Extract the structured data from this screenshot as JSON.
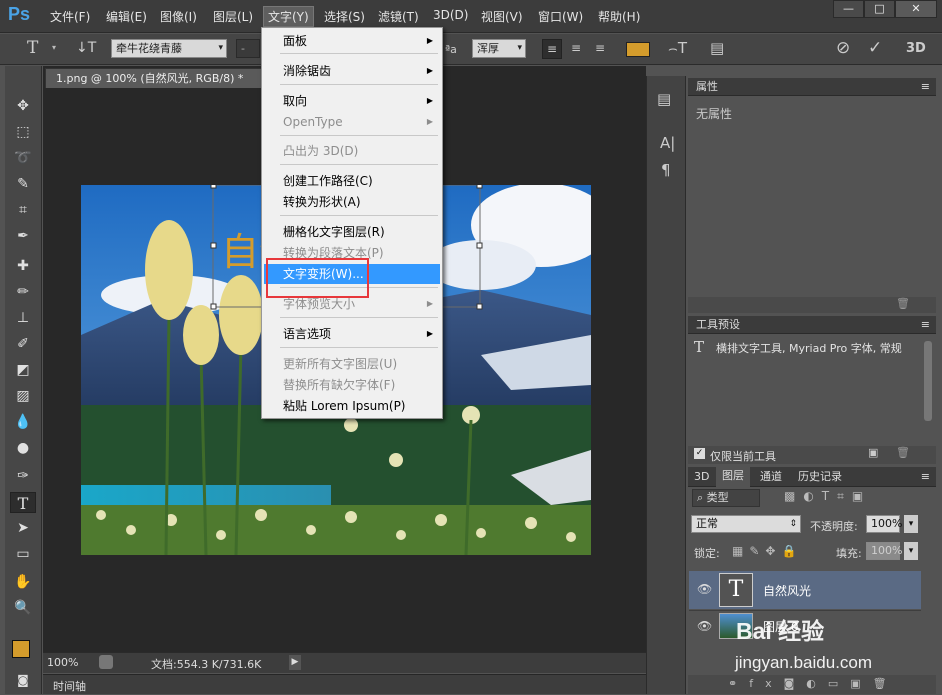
{
  "app": {
    "logo": "Ps"
  },
  "menubar": {
    "items": [
      "文件(F)",
      "编辑(E)",
      "图像(I)",
      "图层(L)",
      "文字(Y)",
      "选择(S)",
      "滤镜(T)",
      "3D(D)",
      "视图(V)",
      "窗口(W)",
      "帮助(H)"
    ],
    "active_index": 4,
    "window_buttons": [
      "—",
      "□",
      "✕"
    ]
  },
  "options": {
    "font_family": "牵牛花绕青藤",
    "font_style": "-",
    "aa_label": "ªa",
    "aa_mode": "浑厚",
    "text_color": "#d49c2c"
  },
  "document": {
    "tab_title": "1.png @ 100% (自然风光, RGB/8) *",
    "tab_close": "×",
    "zoom": "100%",
    "doc_info": "文档:554.3 K/731.6K",
    "timeline_label": "时间轴"
  },
  "dropdown": {
    "items": [
      {
        "label": "面板",
        "submenu": true,
        "disabled": false
      },
      {
        "label": "消除锯齿",
        "submenu": true,
        "disabled": false
      },
      {
        "label": "取向",
        "submenu": true,
        "disabled": false
      },
      {
        "label": "OpenType",
        "submenu": true,
        "disabled": true
      },
      {
        "label": "凸出为 3D(D)",
        "submenu": false,
        "disabled": true
      },
      {
        "label": "创建工作路径(C)",
        "submenu": false,
        "disabled": false
      },
      {
        "label": "转换为形状(A)",
        "submenu": false,
        "disabled": false
      },
      {
        "label": "栅格化文字图层(R)",
        "submenu": false,
        "disabled": false
      },
      {
        "label": "转换为段落文本(P)",
        "submenu": false,
        "disabled": true
      },
      {
        "label": "文字变形(W)...",
        "submenu": false,
        "disabled": false,
        "highlighted": true
      },
      {
        "label": "字体预览大小",
        "submenu": true,
        "disabled": true
      },
      {
        "label": "语言选项",
        "submenu": true,
        "disabled": false
      },
      {
        "label": "更新所有文字图层(U)",
        "submenu": false,
        "disabled": true
      },
      {
        "label": "替换所有缺欠字体(F)",
        "submenu": false,
        "disabled": true
      },
      {
        "label": "粘贴 Lorem Ipsum(P)",
        "submenu": false,
        "disabled": false
      }
    ]
  },
  "panels": {
    "properties": {
      "title": "属性",
      "empty_text": "无属性"
    },
    "tool_presets": {
      "title": "工具预设",
      "preset_text": "横排文字工具, Myriad Pro 字体, 常规",
      "current_only": "仅限当前工具"
    },
    "layers": {
      "tabs": [
        "3D",
        "图层",
        "通道",
        "历史记录"
      ],
      "active_tab": 1,
      "filter_label": "类型",
      "blend_mode": "正常",
      "opacity_label": "不透明度:",
      "opacity_value": "100%",
      "lock_label": "锁定:",
      "fill_label": "填充:",
      "fill_value": "100%",
      "rows": [
        {
          "name": "自然风光",
          "type": "text",
          "thumb": "T",
          "selected": true
        },
        {
          "name": "图层 0",
          "type": "image",
          "selected": false
        }
      ]
    }
  },
  "watermark": {
    "logo": "Bai 经验",
    "url": "jingyan.baidu.com"
  }
}
